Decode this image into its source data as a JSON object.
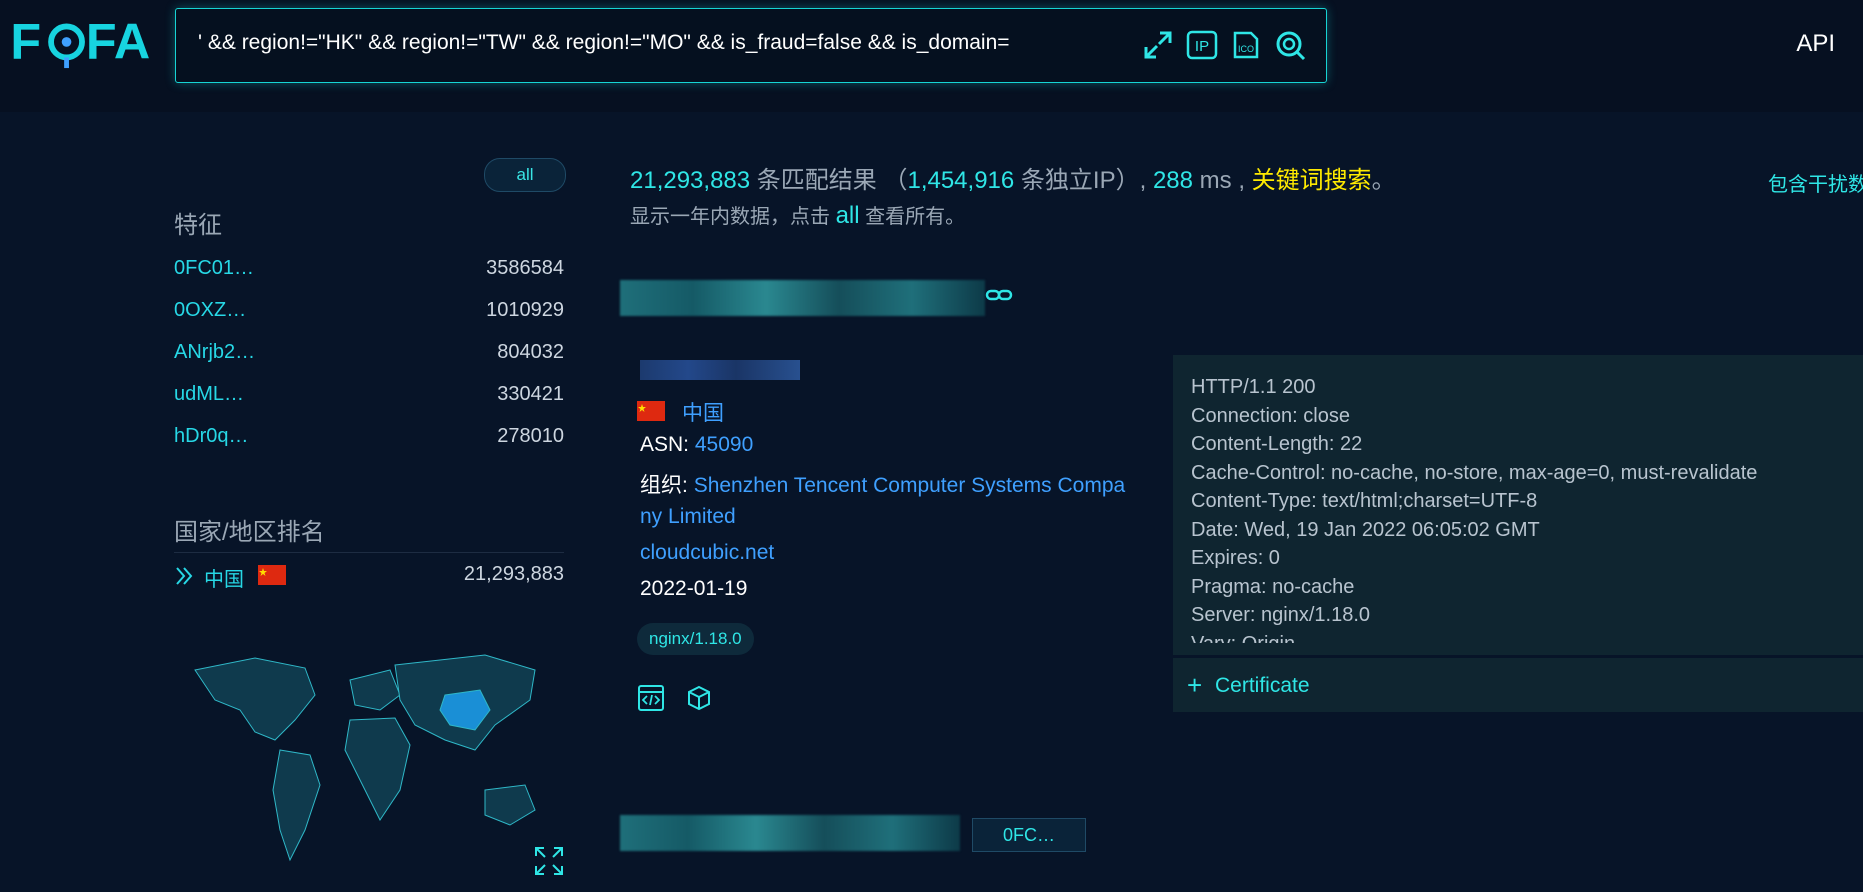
{
  "header": {
    "logo_text": "FOFA",
    "query": "' && region!=\"HK\" && region!=\"TW\" && region!=\"MO\" && is_fraud=false && is_domain=",
    "api_label": "API",
    "icons": [
      "expand-icon",
      "ip-icon",
      "ico-icon",
      "search-icon"
    ],
    "ip_icon_text": "IP",
    "ico_icon_text": "ICO"
  },
  "sidebar": {
    "all_label": "all",
    "features_title": "特征",
    "features": [
      {
        "name": "0FC01…",
        "count": "3586584"
      },
      {
        "name": "0OXZ…",
        "count": "1010929"
      },
      {
        "name": "ANrjb2…",
        "count": "804032"
      },
      {
        "name": "udML…",
        "count": "330421"
      },
      {
        "name": "hDr0q…",
        "count": "278010"
      }
    ],
    "country_title": "国家/地区排名",
    "countries": [
      {
        "name": "中国",
        "count": "21,293,883"
      }
    ]
  },
  "summary": {
    "total": "21,293,883",
    "total_suffix": "条匹配结果",
    "open_paren": " （",
    "unique_ip": "1,454,916",
    "unique_ip_suffix": "条独立IP）,",
    "time": "288",
    "time_unit": "ms ,",
    "keyword": "关键词搜索",
    "period": "。",
    "sub_prefix": "显示一年内数据，点击",
    "sub_all": "all",
    "sub_suffix": "查看所有。",
    "right_link": "包含干扰数据"
  },
  "result": {
    "country": "中国",
    "asn_label": "ASN:",
    "asn": "45090",
    "org_label": "组织:",
    "org_line1": "Shenzhen Tencent Computer Systems Compa",
    "org_line2": "ny Limited",
    "domain": "cloudcubic.net",
    "date": "2022-01-19",
    "server_tag": "nginx/1.18.0",
    "headers": [
      "HTTP/1.1 200",
      "Connection: close",
      "Content-Length: 22",
      "Cache-Control: no-cache, no-store, max-age=0, must-revalidate",
      "Content-Type: text/html;charset=UTF-8",
      "Date: Wed, 19 Jan 2022 06:05:02 GMT",
      "Expires: 0",
      "Pragma: no-cache",
      "Server: nginx/1.18.0",
      "Vary: Origin"
    ],
    "certificate_label": "Certificate",
    "certificate_plus": "+"
  },
  "result2": {
    "chip": "0FC…"
  },
  "colors": {
    "background": "#071428",
    "accent": "#2fe6e6",
    "keyword": "#ffea00",
    "link": "#3fa0ff"
  }
}
